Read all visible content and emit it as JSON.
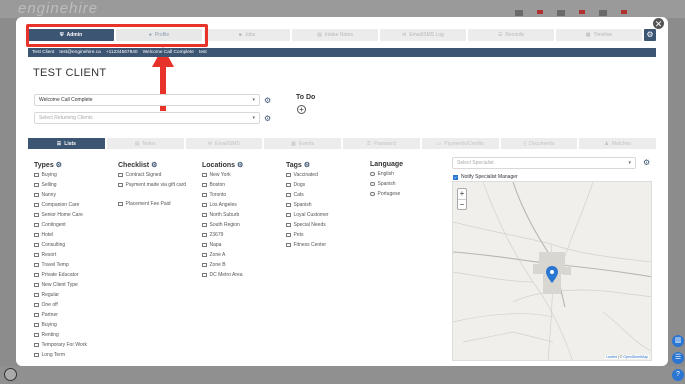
{
  "background": {
    "logo": "enginehire"
  },
  "nav": {
    "tabs": [
      {
        "label": "Admin",
        "icon": "shield-icon"
      },
      {
        "label": "Profile",
        "icon": "user-icon"
      },
      {
        "label": "Jobs",
        "icon": "briefcase-icon"
      },
      {
        "label": "Intake Notes",
        "icon": "notes-icon"
      },
      {
        "label": "Email/SMS Log",
        "icon": "envelope-icon"
      },
      {
        "label": "Records",
        "icon": "list-icon"
      },
      {
        "label": "Timeline",
        "icon": "calendar-icon"
      }
    ]
  },
  "client": {
    "name": "Test Client",
    "email": "test@enginehire.ca",
    "phone": "+11234567840",
    "status": "Welcome Call Complete",
    "extra": "test"
  },
  "page_title": "TEST CLIENT",
  "status_select": {
    "value": "Welcome Call Complete"
  },
  "returning_select": {
    "placeholder": "Select Returning Clients"
  },
  "todo": {
    "title": "To Do"
  },
  "subtabs": [
    {
      "label": "Lists",
      "icon": "list-icon"
    },
    {
      "label": "Notes",
      "icon": "note-icon"
    },
    {
      "label": "Email/SMS",
      "icon": "envelope-icon"
    },
    {
      "label": "Events",
      "icon": "calendar-icon"
    },
    {
      "label": "Password",
      "icon": "key-icon"
    },
    {
      "label": "Payments/Credits",
      "icon": "card-icon"
    },
    {
      "label": "Documents",
      "icon": "document-icon"
    },
    {
      "label": "Matches",
      "icon": "users-icon"
    }
  ],
  "lists": {
    "types": {
      "title": "Types",
      "items": [
        "Buying",
        "Selling",
        "Nanny",
        "Companion Care",
        "Senior Home Care",
        "Contingent",
        "Hotel",
        "Consulting",
        "Resort",
        "Travel Temp",
        "Private Educator",
        "New Client Type",
        "Regular",
        "One off",
        "Partner",
        "Buying",
        "Renting",
        "Temporary For Work",
        "Long Term"
      ]
    },
    "checklist": {
      "title": "Checklist",
      "items": [
        "Contract Signed",
        "Payment made via gift card",
        "Placement Fee Paid"
      ]
    },
    "locations": {
      "title": "Locations",
      "items": [
        "New York",
        "Boston",
        "Toronto",
        "Los Angeles",
        "North Suburb",
        "South Region",
        "23679",
        "Napa",
        "Zone A",
        "Zone B",
        "DC Metro Area"
      ]
    },
    "tags": {
      "title": "Tags",
      "items": [
        "Vaccinated",
        "Dogs",
        "Cats",
        "Spanish",
        "Loyal Customer",
        "Special Needs",
        "Pets",
        "Fitness Center"
      ]
    },
    "language": {
      "title": "Language",
      "items": [
        "English",
        "Spanish",
        "Portugese"
      ]
    }
  },
  "specialist": {
    "placeholder": "Select Specialist",
    "notify_label": "Notify Specialist Manager",
    "notify_checked": true
  },
  "map": {
    "zoom_in": "+",
    "zoom_out": "−",
    "attribution_leaflet": "Leaflet",
    "attribution_sep": " | © ",
    "attribution_osm": "OpenStreetMap"
  },
  "colors": {
    "primary": "#3c5573",
    "highlight": "#e8332a",
    "accent": "#2a76d2"
  }
}
